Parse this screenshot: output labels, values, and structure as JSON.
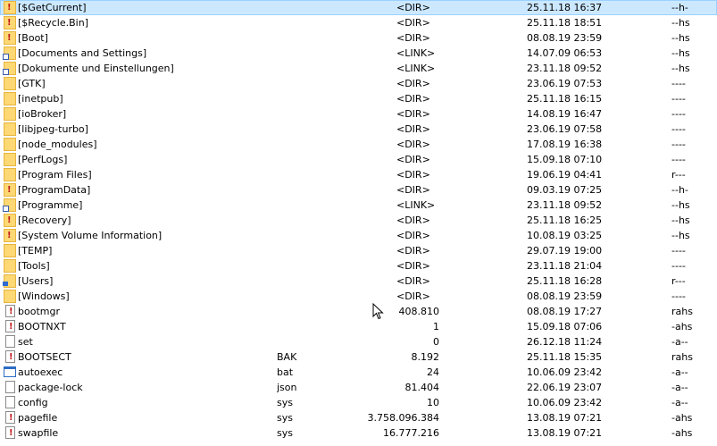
{
  "files": [
    {
      "icon": "folder-hidden-icon",
      "kind": "folder locked",
      "name": "[$GetCurrent]",
      "ext": "",
      "size": "<DIR>",
      "date": "25.11.18 16:37",
      "attr": "--h-",
      "selected": true
    },
    {
      "icon": "folder-hidden-icon",
      "kind": "folder locked",
      "name": "[$Recycle.Bin]",
      "ext": "",
      "size": "<DIR>",
      "date": "25.11.18 18:51",
      "attr": "--hs"
    },
    {
      "icon": "folder-hidden-icon",
      "kind": "folder locked",
      "name": "[Boot]",
      "ext": "",
      "size": "<DIR>",
      "date": "08.08.19 23:59",
      "attr": "--hs"
    },
    {
      "icon": "folder-link-icon",
      "kind": "folder link",
      "name": "[Documents and Settings]",
      "ext": "",
      "size": "<LINK>",
      "date": "14.07.09 06:53",
      "attr": "--hs"
    },
    {
      "icon": "folder-link-icon",
      "kind": "folder link",
      "name": "[Dokumente und Einstellungen]",
      "ext": "",
      "size": "<LINK>",
      "date": "23.11.18 09:52",
      "attr": "--hs"
    },
    {
      "icon": "folder-icon",
      "kind": "folder",
      "name": "[GTK]",
      "ext": "",
      "size": "<DIR>",
      "date": "23.06.19 07:53",
      "attr": "----"
    },
    {
      "icon": "folder-icon",
      "kind": "folder",
      "name": "[inetpub]",
      "ext": "",
      "size": "<DIR>",
      "date": "25.11.18 16:15",
      "attr": "----"
    },
    {
      "icon": "folder-icon",
      "kind": "folder",
      "name": "[ioBroker]",
      "ext": "",
      "size": "<DIR>",
      "date": "14.08.19 16:47",
      "attr": "----"
    },
    {
      "icon": "folder-icon",
      "kind": "folder",
      "name": "[libjpeg-turbo]",
      "ext": "",
      "size": "<DIR>",
      "date": "23.06.19 07:58",
      "attr": "----"
    },
    {
      "icon": "folder-icon",
      "kind": "folder",
      "name": "[node_modules]",
      "ext": "",
      "size": "<DIR>",
      "date": "17.08.19 16:38",
      "attr": "----"
    },
    {
      "icon": "folder-icon",
      "kind": "folder",
      "name": "[PerfLogs]",
      "ext": "",
      "size": "<DIR>",
      "date": "15.09.18 07:10",
      "attr": "----"
    },
    {
      "icon": "folder-icon",
      "kind": "folder",
      "name": "[Program Files]",
      "ext": "",
      "size": "<DIR>",
      "date": "19.06.19 04:41",
      "attr": "r---"
    },
    {
      "icon": "folder-hidden-icon",
      "kind": "folder locked",
      "name": "[ProgramData]",
      "ext": "",
      "size": "<DIR>",
      "date": "09.03.19 07:25",
      "attr": "--h-"
    },
    {
      "icon": "folder-link-icon",
      "kind": "folder link",
      "name": "[Programme]",
      "ext": "",
      "size": "<LINK>",
      "date": "23.11.18 09:52",
      "attr": "--hs"
    },
    {
      "icon": "folder-hidden-icon",
      "kind": "folder locked",
      "name": "[Recovery]",
      "ext": "",
      "size": "<DIR>",
      "date": "25.11.18 16:25",
      "attr": "--hs"
    },
    {
      "icon": "folder-hidden-icon",
      "kind": "folder locked",
      "name": "[System Volume Information]",
      "ext": "",
      "size": "<DIR>",
      "date": "10.08.19 03:25",
      "attr": "--hs"
    },
    {
      "icon": "folder-icon",
      "kind": "folder",
      "name": "[TEMP]",
      "ext": "",
      "size": "<DIR>",
      "date": "29.07.19 19:00",
      "attr": "----"
    },
    {
      "icon": "folder-icon",
      "kind": "folder",
      "name": "[Tools]",
      "ext": "",
      "size": "<DIR>",
      "date": "23.11.18 21:04",
      "attr": "----"
    },
    {
      "icon": "folder-users-icon",
      "kind": "folder user",
      "name": "[Users]",
      "ext": "",
      "size": "<DIR>",
      "date": "25.11.18 16:28",
      "attr": "r---"
    },
    {
      "icon": "folder-icon",
      "kind": "folder",
      "name": "[Windows]",
      "ext": "",
      "size": "<DIR>",
      "date": "08.08.19 23:59",
      "attr": "----"
    },
    {
      "icon": "system-file-icon",
      "kind": "file sys",
      "name": "bootmgr",
      "ext": "",
      "size": "408.810",
      "date": "08.08.19 17:27",
      "attr": "rahs"
    },
    {
      "icon": "system-file-icon",
      "kind": "file sys",
      "name": "BOOTNXT",
      "ext": "",
      "size": "1",
      "date": "15.09.18 07:06",
      "attr": "-ahs"
    },
    {
      "icon": "file-icon",
      "kind": "file",
      "name": "set",
      "ext": "",
      "size": "0",
      "date": "26.12.18 11:24",
      "attr": "-a--"
    },
    {
      "icon": "system-file-icon",
      "kind": "file sys",
      "name": "BOOTSECT",
      "ext": "BAK",
      "size": "8.192",
      "date": "25.11.18 15:35",
      "attr": "rahs"
    },
    {
      "icon": "batch-file-icon",
      "kind": "app",
      "name": "autoexec",
      "ext": "bat",
      "size": "24",
      "date": "10.06.09 23:42",
      "attr": "-a--"
    },
    {
      "icon": "file-icon",
      "kind": "file",
      "name": "package-lock",
      "ext": "json",
      "size": "81.404",
      "date": "22.06.19 23:07",
      "attr": "-a--"
    },
    {
      "icon": "file-icon",
      "kind": "file",
      "name": "config",
      "ext": "sys",
      "size": "10",
      "date": "10.06.09 23:42",
      "attr": "-a--"
    },
    {
      "icon": "system-file-icon",
      "kind": "file sys",
      "name": "pagefile",
      "ext": "sys",
      "size": "3.758.096.384",
      "date": "13.08.19 07:21",
      "attr": "-ahs"
    },
    {
      "icon": "system-file-icon",
      "kind": "file sys",
      "name": "swapfile",
      "ext": "sys",
      "size": "16.777.216",
      "date": "13.08.19 07:21",
      "attr": "-ahs"
    }
  ]
}
